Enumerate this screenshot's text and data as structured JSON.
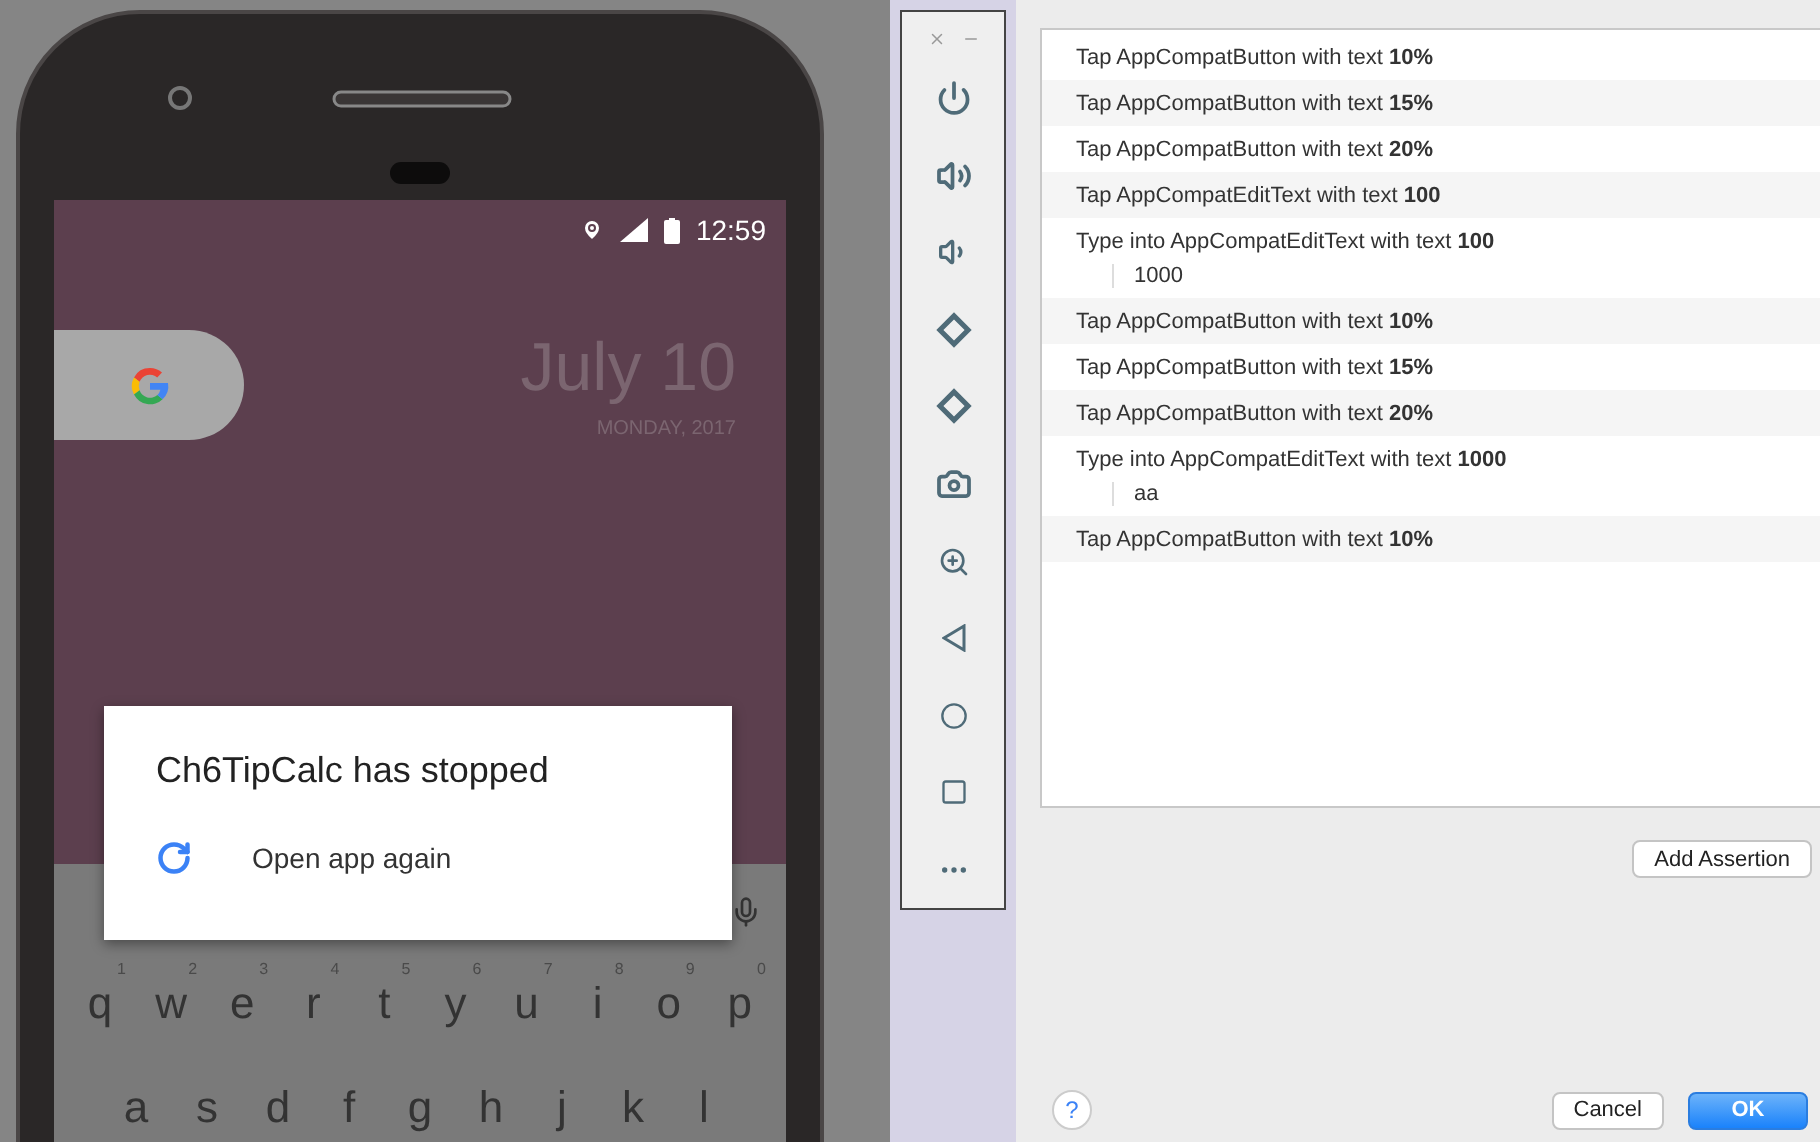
{
  "phone": {
    "status_bar": {
      "time": "12:59"
    },
    "home": {
      "date": "July 10",
      "day": "MONDAY, 2017"
    },
    "dialog": {
      "title": "Ch6TipCalc has stopped",
      "action": "Open app again"
    },
    "keyboard": {
      "rows": [
        {
          "keys": [
            {
              "letter": "q",
              "hint": "1"
            },
            {
              "letter": "w",
              "hint": "2"
            },
            {
              "letter": "e",
              "hint": "3"
            },
            {
              "letter": "r",
              "hint": "4"
            },
            {
              "letter": "t",
              "hint": "5"
            },
            {
              "letter": "y",
              "hint": "6"
            },
            {
              "letter": "u",
              "hint": "7"
            },
            {
              "letter": "i",
              "hint": "8"
            },
            {
              "letter": "o",
              "hint": "9"
            },
            {
              "letter": "p",
              "hint": "0"
            }
          ]
        },
        {
          "keys": [
            {
              "letter": "a"
            },
            {
              "letter": "s"
            },
            {
              "letter": "d"
            },
            {
              "letter": "f"
            },
            {
              "letter": "g"
            },
            {
              "letter": "h"
            },
            {
              "letter": "j"
            },
            {
              "letter": "k"
            },
            {
              "letter": "l"
            }
          ]
        }
      ]
    }
  },
  "recorder": {
    "events": [
      {
        "text": "Tap AppCompatButton with text **10%**"
      },
      {
        "text": "Tap AppCompatButton with text **15%**"
      },
      {
        "text": "Tap AppCompatButton with text **20%**"
      },
      {
        "text": "Tap AppCompatEditText with text **100**"
      },
      {
        "text": "Type into AppCompatEditText with text **100**",
        "input": "1000"
      },
      {
        "text": "Tap AppCompatButton with text **10%**"
      },
      {
        "text": "Tap AppCompatButton with text **15%**"
      },
      {
        "text": "Tap AppCompatButton with text **20%**"
      },
      {
        "text": "Type into AppCompatEditText with text **1000**",
        "input": "aa"
      },
      {
        "text": "Tap AppCompatButton with text **10%**"
      }
    ],
    "add_assertion": "Add Assertion",
    "help": "?",
    "buttons": [
      {
        "label": "Cancel",
        "primary": false
      },
      {
        "label": "OK",
        "primary": true
      }
    ]
  }
}
